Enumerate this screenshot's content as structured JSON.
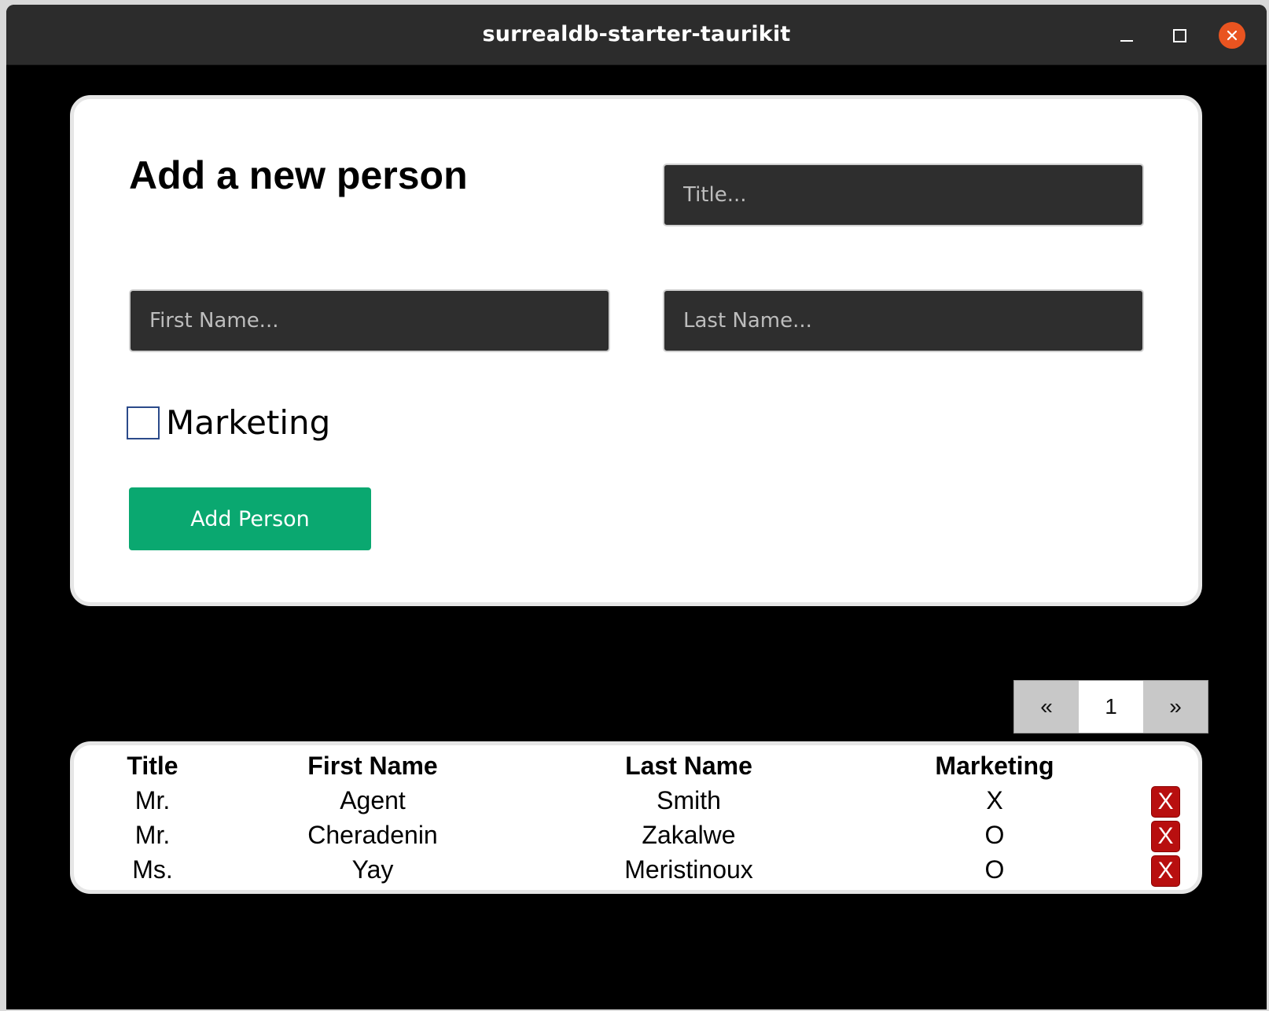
{
  "window": {
    "title": "surrealdb-starter-taurikit"
  },
  "form": {
    "heading": "Add a new person",
    "title_placeholder": "Title...",
    "first_name_placeholder": "First Name...",
    "last_name_placeholder": "Last Name...",
    "marketing_label": "Marketing",
    "marketing_checked": false,
    "submit_label": "Add Person"
  },
  "pagination": {
    "prev_label": "«",
    "current_page": "1",
    "next_label": "»"
  },
  "table": {
    "headers": {
      "title": "Title",
      "first_name": "First Name",
      "last_name": "Last Name",
      "marketing": "Marketing"
    },
    "rows": [
      {
        "title": "Mr.",
        "first_name": "Agent",
        "last_name": "Smith",
        "marketing": "X",
        "delete_label": "X"
      },
      {
        "title": "Mr.",
        "first_name": "Cheradenin",
        "last_name": "Zakalwe",
        "marketing": "O",
        "delete_label": "X"
      },
      {
        "title": "Ms.",
        "first_name": "Yay",
        "last_name": "Meristinoux",
        "marketing": "O",
        "delete_label": "X"
      }
    ]
  },
  "colors": {
    "background": "#000000",
    "titlebar": "#2c2c2c",
    "close_button": "#e95420",
    "input_background": "#2e2e2e",
    "submit_button": "#0aa870",
    "delete_button": "#b80f0f"
  }
}
